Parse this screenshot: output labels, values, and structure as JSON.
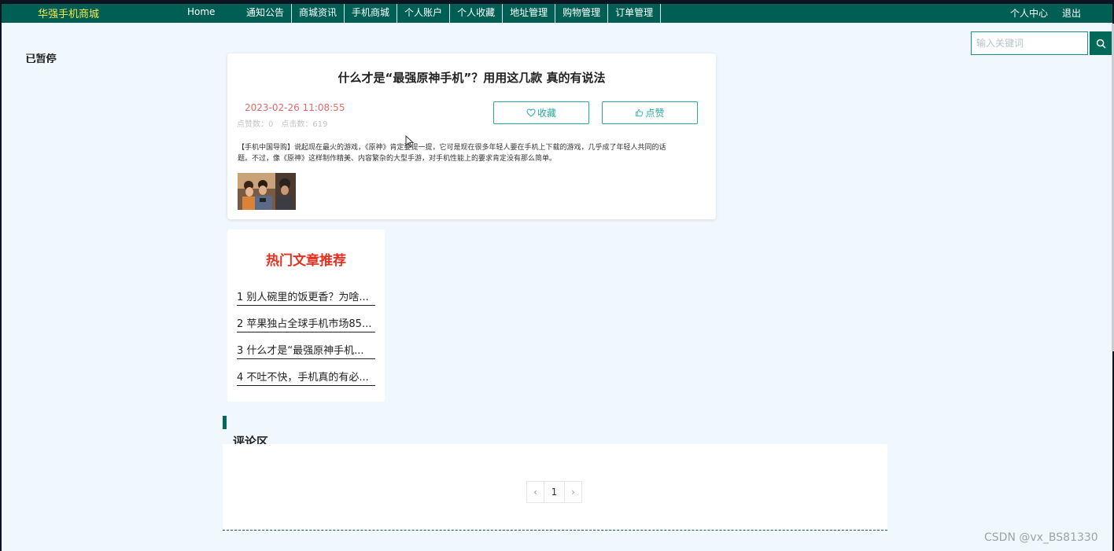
{
  "nav": {
    "brand": "华强手机商城",
    "home": "Home",
    "items": [
      "通知公告",
      "商城资讯",
      "手机商城",
      "个人账户",
      "个人收藏",
      "地址管理",
      "购物管理",
      "订单管理"
    ],
    "right": [
      "个人中心",
      "退出"
    ]
  },
  "search": {
    "placeholder": "输入关键词",
    "icon": "search-icon"
  },
  "status_text": "已暂停",
  "article": {
    "title": "什么才是“最强原神手机”？用用这几款 真的有说法",
    "date": "2023-02-26 11:08:55",
    "likes_label": "点赞数：",
    "likes": "0",
    "clicks_label": "点击数：",
    "clicks": "619",
    "favorite_label": "收藏",
    "like_label": "点赞",
    "body": "【手机中国导购】说起现在最火的游戏，《原神》肯定要提一提，它可是现在很多年轻人要在手机上下载的游戏，几乎成了年轻人共同的话题。不过，像《原神》这样制作精美、内容繁杂的大型手游，对手机性能上的要求肯定没有那么简单。"
  },
  "hot": {
    "title": "热门文章推荐",
    "items": [
      "1 别人碗里的饭更香？为啥...",
      "2 苹果独占全球手机市场85...",
      "3 什么才是“最强原神手机...",
      "4 不吐不快，手机真的有必..."
    ]
  },
  "comments": {
    "title": "评论区",
    "pager": {
      "prev": "‹",
      "current": "1",
      "next": "›"
    }
  },
  "watermark": "CSDN @vx_BS81330",
  "colors": {
    "nav_bg": "#005f55",
    "brand": "#f5e94a",
    "accent": "#2aa8a0",
    "hot_title": "#e8301e",
    "date": "#e46a6a"
  }
}
